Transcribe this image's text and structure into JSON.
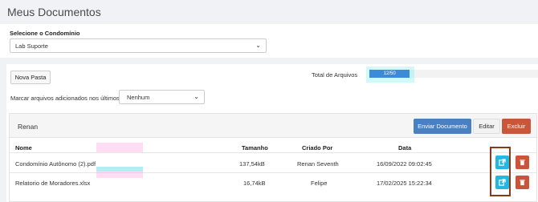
{
  "page": {
    "title": "Meus Documentos"
  },
  "condominio": {
    "label": "Selecione o Condomínio",
    "selected": "Lab Suporte"
  },
  "toolbar": {
    "nova_pasta": "Nova Pasta",
    "total_label": "Total de Arquivos",
    "total_value": "12/50",
    "usage_fraction": 0.24
  },
  "filter": {
    "label": "Marcar arquivos adicionados nos últimos:",
    "selected": "Nenhum"
  },
  "folder": {
    "name": "Renan",
    "actions": {
      "enviar": "Enviar Documento",
      "editar": "Editar",
      "excluir": "Excluir"
    },
    "columns": {
      "nome": "Nome",
      "tamanho": "Tamanho",
      "criado_por": "Criado Por",
      "data": "Data"
    },
    "rows": [
      {
        "nome": "Condomínio Autônomo (2).pdf",
        "tamanho": "137,54kB",
        "criado_por": "Renan Seventh",
        "data": "16/09/2022 09:02:45"
      },
      {
        "nome": "Relatorio de Moradores.xlsx",
        "tamanho": "16,74kB",
        "criado_por": "Felipe",
        "data": "17/02/2025 15:22:34"
      }
    ]
  },
  "icons": {
    "edit": "external-link-icon",
    "delete": "trash-icon",
    "dropdown": "chevron-down-icon"
  },
  "colors": {
    "primary": "#4a7fc1",
    "danger": "#c9553a",
    "info": "#24b8e0",
    "progress": "#3d8bd8"
  }
}
